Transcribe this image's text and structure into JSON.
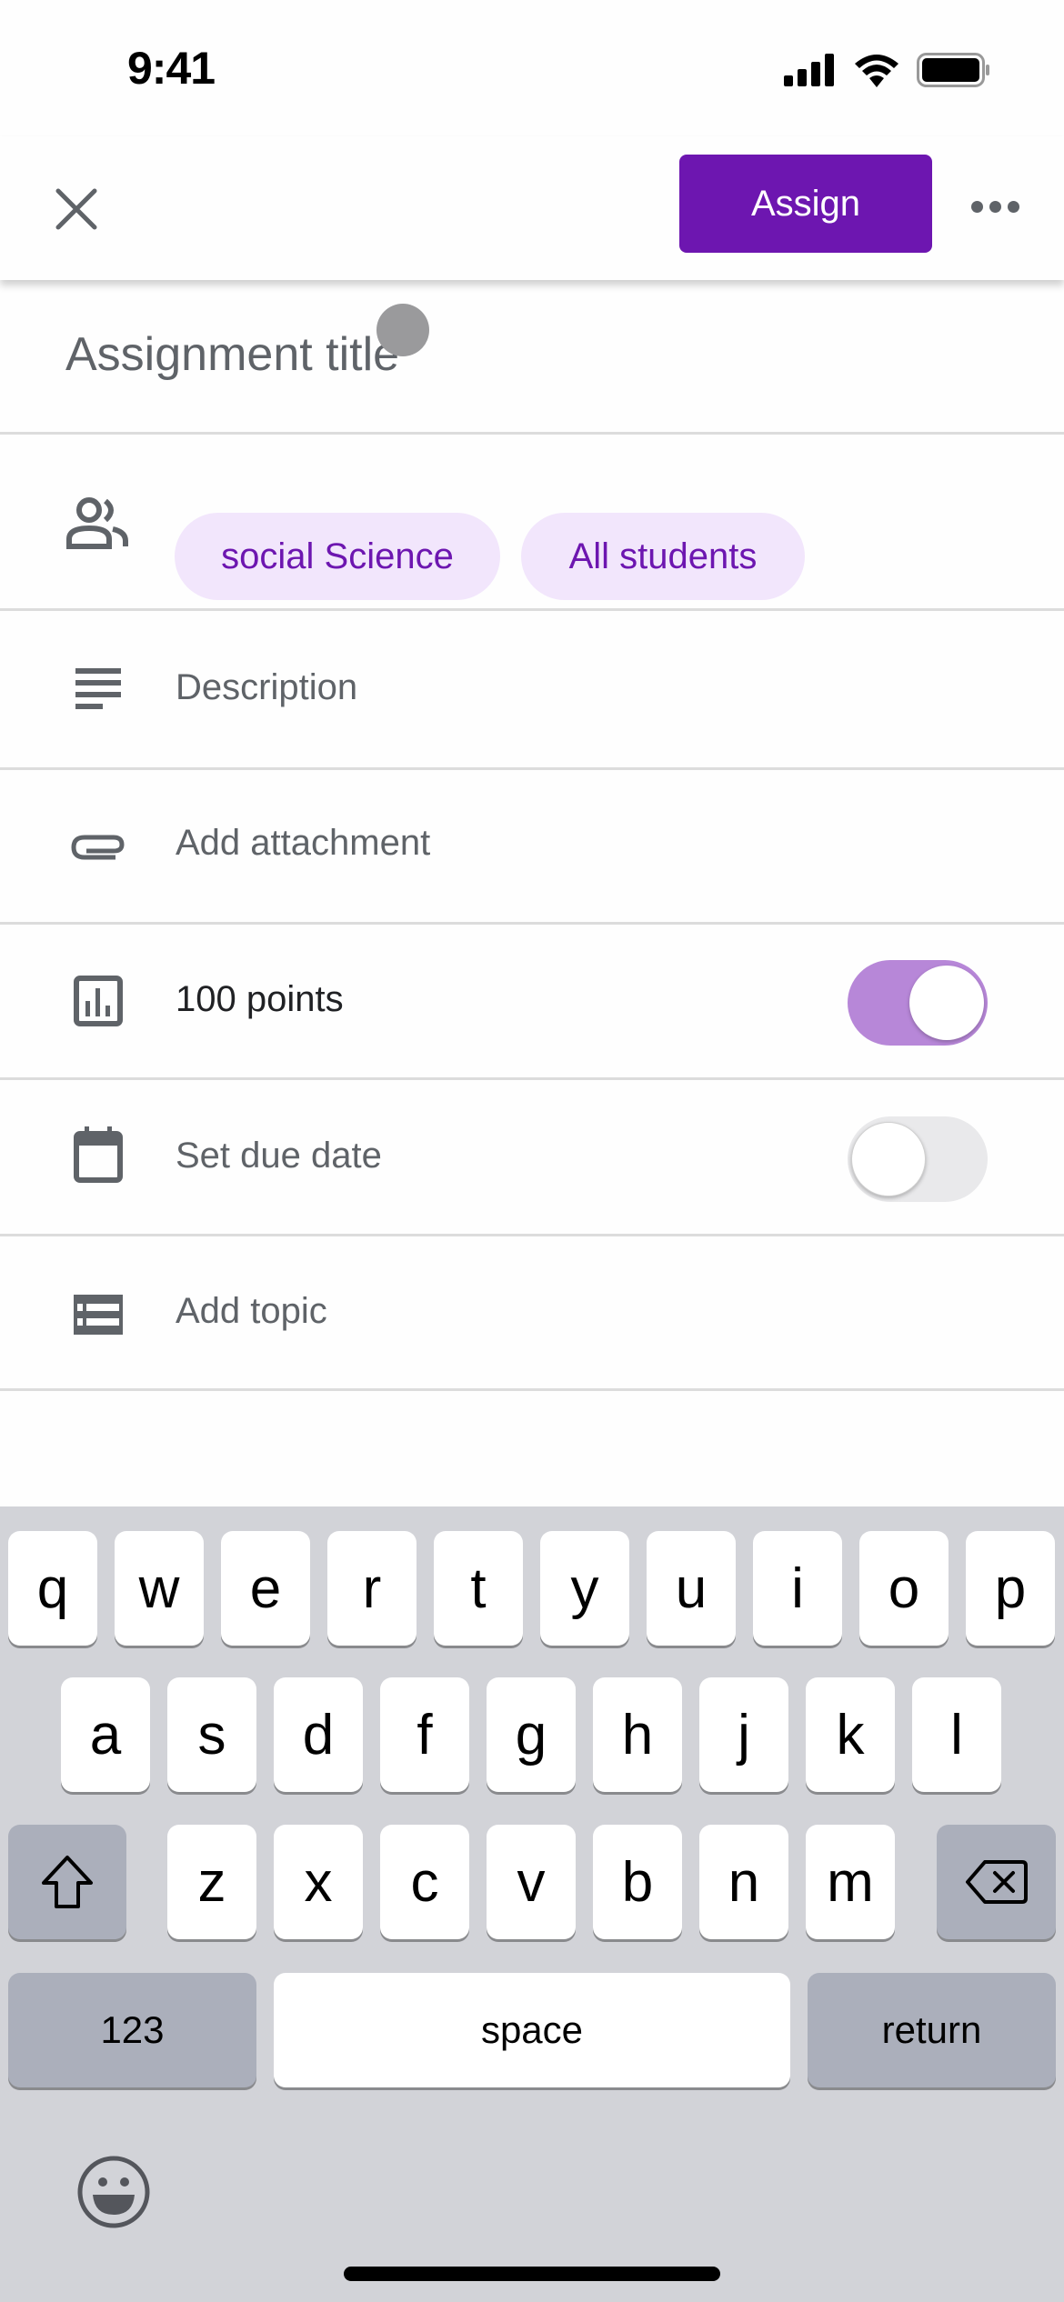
{
  "status_bar": {
    "time": "9:41"
  },
  "header": {
    "close_icon": "close-icon",
    "assign_label": "Assign",
    "more_icon": "more-horiz-icon",
    "accent": "#6d16b0"
  },
  "title": {
    "placeholder": "Assignment title"
  },
  "audience": {
    "chips": [
      "social Science",
      "All students"
    ]
  },
  "rows": {
    "description": "Description",
    "attachment": "Add attachment",
    "points": {
      "label": "100 points",
      "enabled": true
    },
    "due_date": {
      "label": "Set due date",
      "enabled": false
    },
    "topic": "Add topic"
  },
  "keyboard": {
    "row1": [
      "q",
      "w",
      "e",
      "r",
      "t",
      "y",
      "u",
      "i",
      "o",
      "p"
    ],
    "row2": [
      "a",
      "s",
      "d",
      "f",
      "g",
      "h",
      "j",
      "k",
      "l"
    ],
    "row3": [
      "z",
      "x",
      "c",
      "v",
      "b",
      "n",
      "m"
    ],
    "numbers": "123",
    "space": "space",
    "return": "return"
  }
}
